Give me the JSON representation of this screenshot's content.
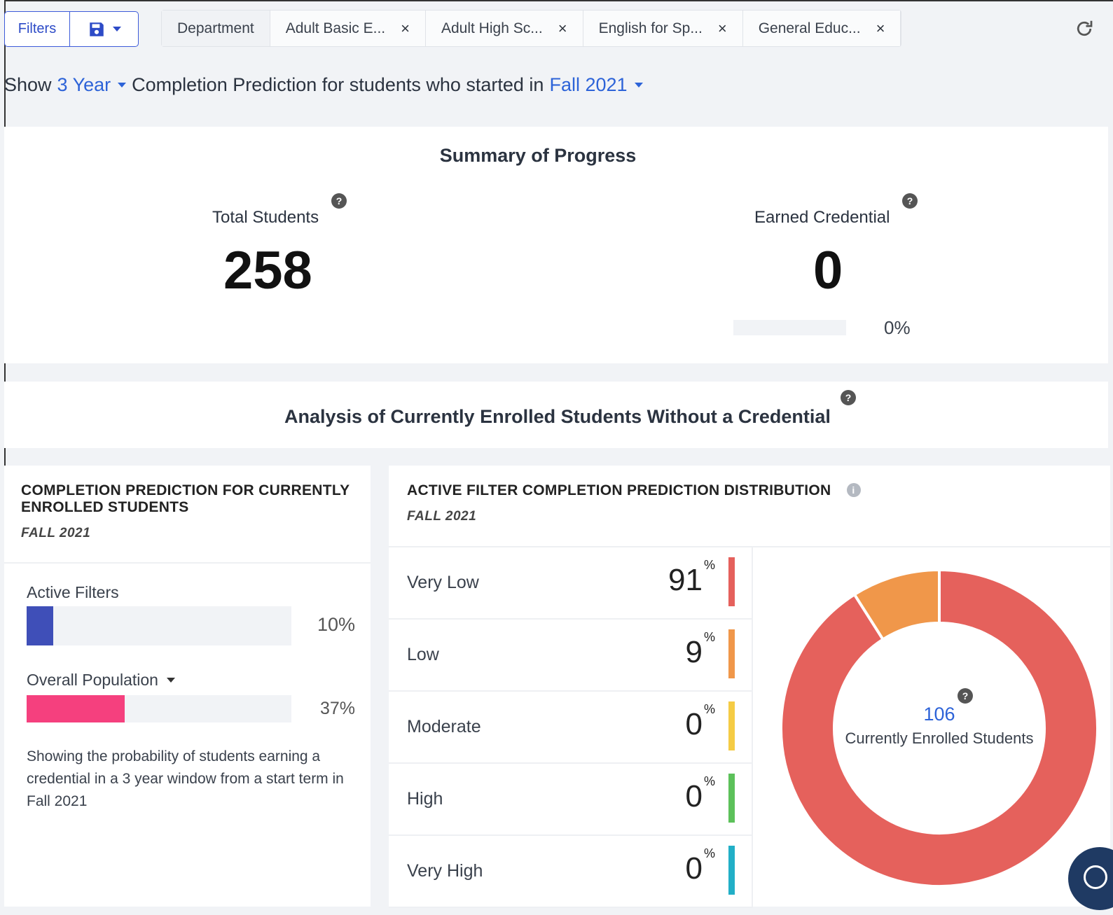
{
  "toolbar": {
    "filters_label": "Filters",
    "save_icon": "floppy-disk-icon",
    "tabs": [
      {
        "label": "Department",
        "closable": false
      },
      {
        "label": "Adult Basic E...",
        "closable": true
      },
      {
        "label": "Adult High Sc...",
        "closable": true
      },
      {
        "label": "English for Sp...",
        "closable": true
      },
      {
        "label": "General Educ...",
        "closable": true
      }
    ],
    "close_glyph": "×",
    "refresh_icon": "refresh-icon"
  },
  "headline": {
    "show": "Show",
    "window": "3 Year",
    "middle": "Completion Prediction for students who started in",
    "term": "Fall 2021"
  },
  "summary": {
    "title": "Summary of Progress",
    "total_label": "Total Students",
    "total_value": "258",
    "earned_label": "Earned Credential",
    "earned_value": "0",
    "earned_pct": "0%",
    "earned_fraction": 0
  },
  "analysis": {
    "title": "Analysis of Currently Enrolled Students Without a Credential"
  },
  "left_card": {
    "title": "COMPLETION PREDICTION FOR CURRENTLY ENROLLED STUDENTS",
    "subtitle": "FALL 2021",
    "active_label": "Active Filters",
    "active_pct": "10%",
    "active_fraction": 0.1,
    "overall_label": "Overall Population",
    "overall_pct": "37%",
    "overall_fraction": 0.37,
    "description": "Showing the probability of students earning a credential in a 3 year window from a start term in Fall 2021",
    "colors": {
      "active": "#3f4fb8",
      "overall": "#f5407e"
    }
  },
  "right_card": {
    "title": "ACTIVE FILTER COMPLETION PREDICTION DISTRIBUTION",
    "subtitle": "FALL 2021",
    "percent_sign": "%",
    "rows": [
      {
        "label": "Very Low",
        "value": "91",
        "color": "#e5615c"
      },
      {
        "label": "Low",
        "value": "9",
        "color": "#f0974a"
      },
      {
        "label": "Moderate",
        "value": "0",
        "color": "#f5cc45"
      },
      {
        "label": "High",
        "value": "0",
        "color": "#5cc15a"
      },
      {
        "label": "Very High",
        "value": "0",
        "color": "#22afc7"
      }
    ],
    "donut": {
      "center_value": "106",
      "center_label": "Currently Enrolled Students",
      "segments": [
        {
          "value": 91,
          "color": "#e5615c"
        },
        {
          "value": 9,
          "color": "#f0974a"
        }
      ]
    }
  }
}
